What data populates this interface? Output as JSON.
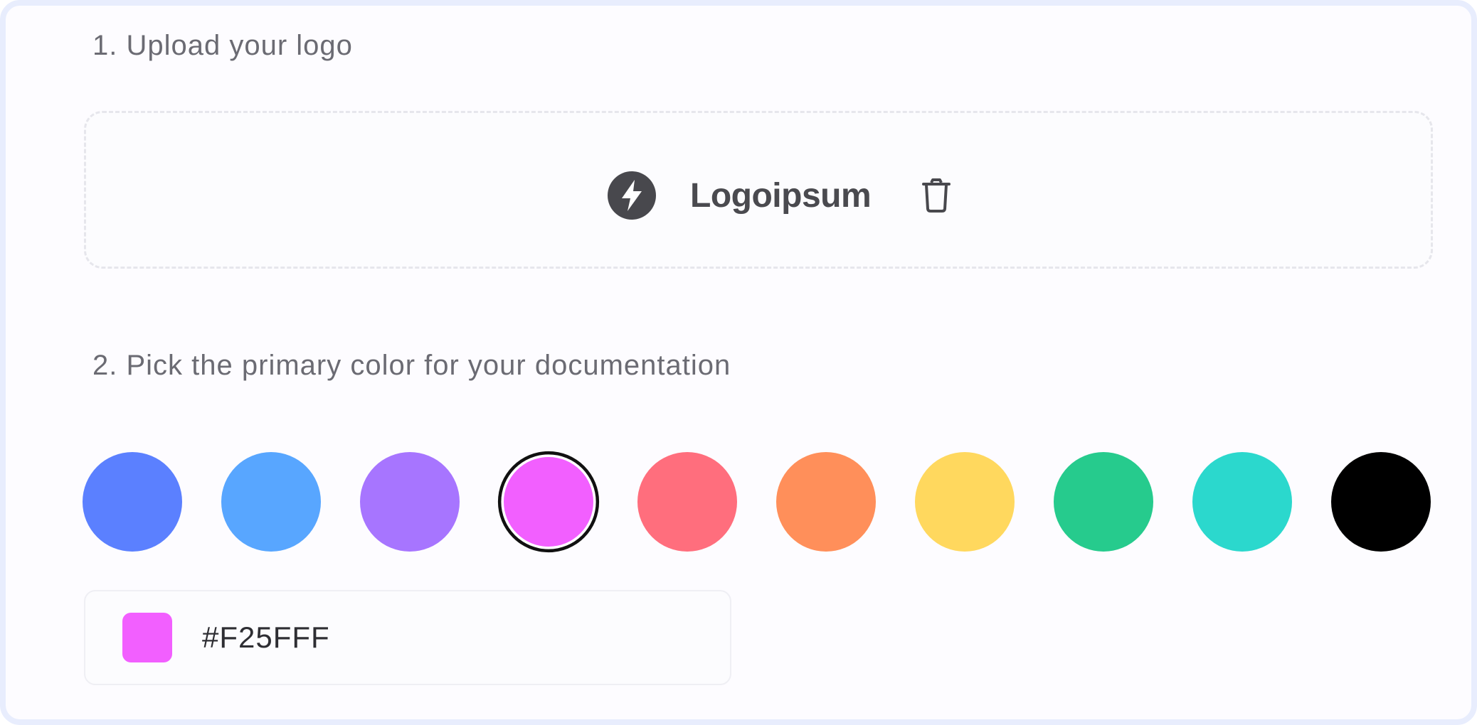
{
  "steps": {
    "upload_label": "1. Upload your logo",
    "color_label": "2. Pick the primary color for your documentation"
  },
  "logo": {
    "name": "Logoipsum",
    "mark_icon": "bolt-circle-icon",
    "delete_icon": "trash-icon"
  },
  "palette": {
    "selected_index": 3,
    "colors": [
      "#5b80ff",
      "#58a6ff",
      "#a775ff",
      "#f25fff",
      "#ff6e7d",
      "#ff8f5a",
      "#ffd85e",
      "#26cb8d",
      "#2bd8cd",
      "#000000"
    ]
  },
  "hex_input": {
    "value": "#F25FFF",
    "preview_color": "#F25FFF"
  }
}
